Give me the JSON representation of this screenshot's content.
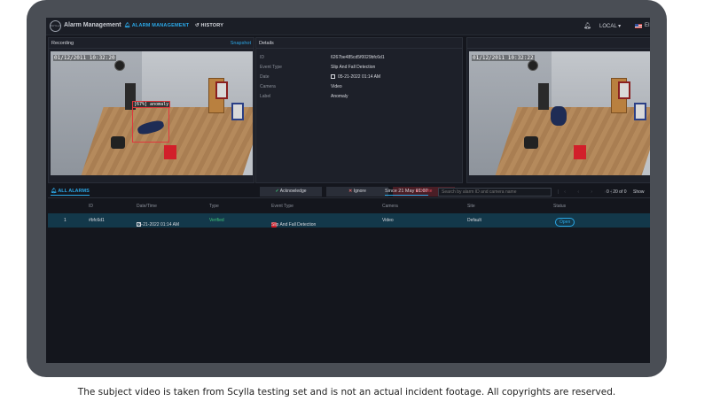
{
  "app": {
    "title": "Alarm Management",
    "logo_text": "SCYLLA"
  },
  "nav": {
    "alarm_management": "ALARM MANAGEMENT",
    "history": "HISTORY",
    "local": "LOCAL",
    "lang": "EI"
  },
  "recording": {
    "title": "Recording",
    "snapshot": "Snapshot",
    "timestamp": "01/12/2011 10:32:20",
    "box_label": "[67%] anomaly"
  },
  "details": {
    "title": "Details",
    "fields": [
      {
        "key": "ID",
        "value": "6267be485cd5f0029bfc6d1"
      },
      {
        "key": "Event Type",
        "value": "Slip And Fall Detection"
      },
      {
        "key": "Date",
        "value": "05-21-2022 01:14 AM"
      },
      {
        "key": "Camera",
        "value": "Video"
      },
      {
        "key": "Label",
        "value": "Anomaly"
      }
    ],
    "acknowledge": "Acknowledge",
    "ignore": "Ignore",
    "delete": "Delete"
  },
  "live": {
    "timestamp": "01/12/2011 10:32:22"
  },
  "alarms": {
    "tab": "ALL ALARMS",
    "since": "Since 21 May 01:07",
    "search_placeholder": "Search by alarm ID and camera name",
    "count": "0 - 20 of 0",
    "show": "Show",
    "columns": [
      "ID",
      "Date/Time",
      "Type",
      "Event Type",
      "Camera",
      "Site",
      "Status"
    ],
    "rows": [
      {
        "num": "1",
        "id": "#bfc6d1",
        "date": "05-21-2022 01:14 AM",
        "type": "Verified",
        "event": "Slip And Fall Detection",
        "camera": "Video",
        "site": "Default",
        "status": "Open"
      }
    ]
  },
  "caption": "The subject video is taken from Scylla testing set and is not an actual incident footage. All copyrights are reserved."
}
